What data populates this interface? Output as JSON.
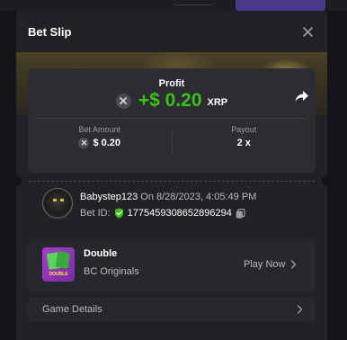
{
  "modal": {
    "title": "Bet Slip"
  },
  "profit": {
    "label": "Profit",
    "value": "+$ 0.20",
    "currency": "XRP"
  },
  "stats": {
    "bet_amount_label": "Bet Amount",
    "bet_amount_value": "$ 0.20",
    "payout_label": "Payout",
    "payout_value": "2 x"
  },
  "user": {
    "name": "Babystep123",
    "time": "On 8/28/2023, 4:05:49 PM",
    "bet_id_label": "Bet ID:",
    "bet_id": "1775459308652896294"
  },
  "game": {
    "name": "Double",
    "provider": "BC Originals",
    "thumb_label": "DOUBLE",
    "play_label": "Play Now"
  },
  "details": {
    "label": "Game Details"
  },
  "colors": {
    "profit_green": "#3bc117",
    "verified_green": "#3bc117",
    "panel": "#202226",
    "card": "#2b2d32"
  },
  "icons": [
    "close-icon",
    "share-icon",
    "coin-icon",
    "shield-check-icon",
    "copy-icon",
    "chevron-right-icon"
  ]
}
